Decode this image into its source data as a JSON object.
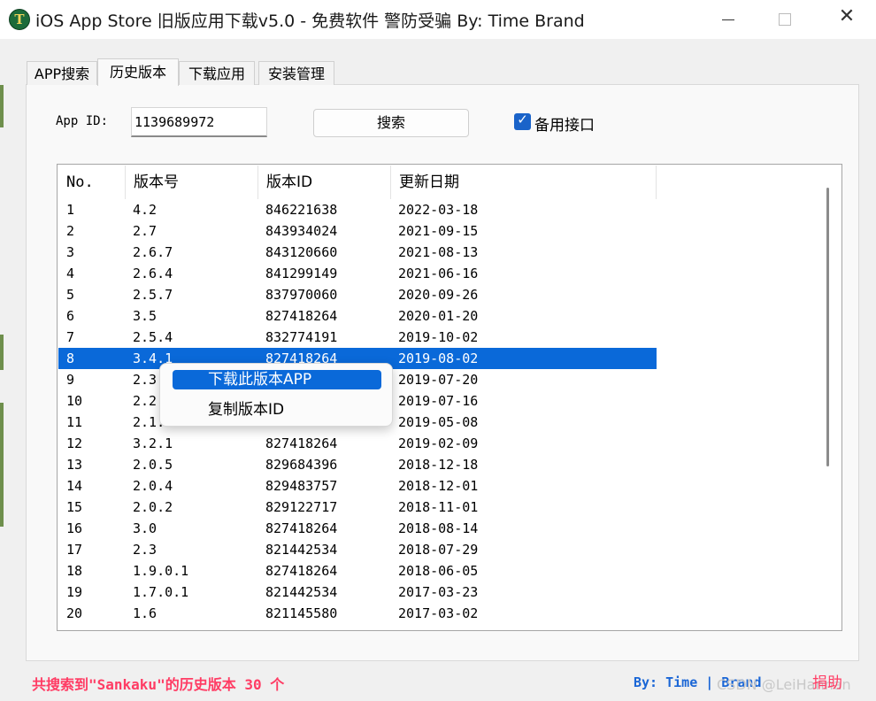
{
  "window": {
    "title": "iOS App Store 旧版应用下载v5.0 - 免费软件 警防受骗 By: Time Brand",
    "icon_letter": "T",
    "close_glyph": "✕"
  },
  "tabs": [
    "APP搜索",
    "历史版本",
    "下载应用",
    "安装管理"
  ],
  "form": {
    "app_id_label": "App ID:",
    "app_id_value": "1139689972",
    "search_button": "搜索",
    "backup_checkbox_label": "备用接口",
    "backup_checked": true
  },
  "table": {
    "columns": [
      "No.",
      "版本号",
      "版本ID",
      "更新日期"
    ],
    "rows": [
      [
        "1",
        "4.2",
        "846221638",
        "2022-03-18"
      ],
      [
        "2",
        "2.7",
        "843934024",
        "2021-09-15"
      ],
      [
        "3",
        "2.6.7",
        "843120660",
        "2021-08-13"
      ],
      [
        "4",
        "2.6.4",
        "841299149",
        "2021-06-16"
      ],
      [
        "5",
        "2.5.7",
        "837970060",
        "2020-09-26"
      ],
      [
        "6",
        "3.5",
        "827418264",
        "2020-01-20"
      ],
      [
        "7",
        "2.5.4",
        "832774191",
        "2019-10-02"
      ],
      [
        "8",
        "3.4.1",
        "827418264",
        "2019-08-02"
      ],
      [
        "9",
        "2.3",
        "",
        "2019-07-20"
      ],
      [
        "10",
        "2.2",
        "",
        "2019-07-16"
      ],
      [
        "11",
        "2.1.",
        "",
        "2019-05-08"
      ],
      [
        "12",
        "3.2.1",
        "827418264",
        "2019-02-09"
      ],
      [
        "13",
        "2.0.5",
        "829684396",
        "2018-12-18"
      ],
      [
        "14",
        "2.0.4",
        "829483757",
        "2018-12-01"
      ],
      [
        "15",
        "2.0.2",
        "829122717",
        "2018-11-01"
      ],
      [
        "16",
        "3.0",
        "827418264",
        "2018-08-14"
      ],
      [
        "17",
        "2.3",
        "821442534",
        "2018-07-29"
      ],
      [
        "18",
        "1.9.0.1",
        "827418264",
        "2018-06-05"
      ],
      [
        "19",
        "1.7.0.1",
        "821442534",
        "2017-03-23"
      ],
      [
        "20",
        "1.6",
        "821145580",
        "2017-03-02"
      ]
    ],
    "selected_row": 8
  },
  "context_menu": {
    "items": [
      "下载此版本APP",
      "复制版本ID"
    ],
    "highlighted": 0
  },
  "footer": {
    "status": "共搜索到\"Sankaku\"的历史版本 30 个",
    "byline": "By: Time | Brand",
    "donate": "捐助",
    "watermark": "CSDN @LeiHannan"
  },
  "colors": {
    "selection": "#0a69d9",
    "status_text": "#ff3c64",
    "byline_text": "#1a66d6",
    "checkbox": "#1a63c9"
  }
}
